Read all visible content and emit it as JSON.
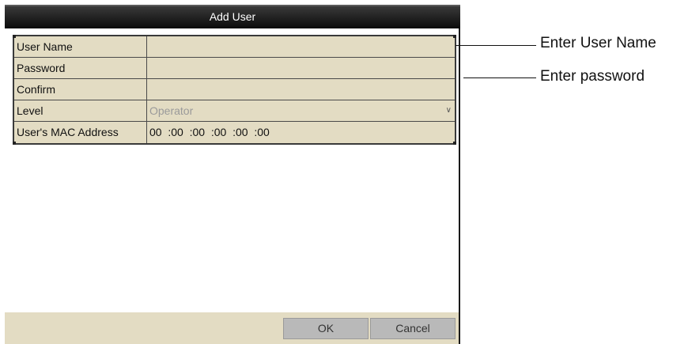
{
  "dialog": {
    "title": "Add User",
    "fields": [
      {
        "label": "User Name",
        "value": ""
      },
      {
        "label": "Password",
        "value": ""
      },
      {
        "label": "Confirm",
        "value": ""
      },
      {
        "label": "Level",
        "value": "Operator"
      },
      {
        "label": "User's MAC Address",
        "value": "00  :00  :00  :00  :00  :00"
      }
    ],
    "ok_label": "OK",
    "cancel_label": "Cancel"
  },
  "callouts": {
    "username": "Enter User Name",
    "password": "Enter password"
  }
}
